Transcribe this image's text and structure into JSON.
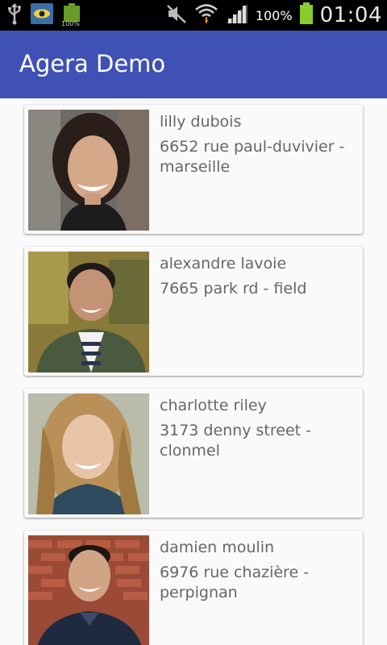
{
  "status_bar": {
    "icons": [
      "usb-icon",
      "eye-app-icon",
      "battery-full-notification-icon",
      "mute-icon",
      "wifi-icon",
      "signal-icon",
      "battery-icon"
    ],
    "battery_notification_text": "100%",
    "battery_percent": "100%",
    "time": "01:04"
  },
  "app_bar": {
    "title": "Agera Demo",
    "color": "#3f51b5"
  },
  "people": [
    {
      "name": "lilly dubois",
      "address": "6652 rue paul-duvivier - marseille"
    },
    {
      "name": "alexandre lavoie",
      "address": "7665 park rd - field"
    },
    {
      "name": "charlotte riley",
      "address": "3173 denny street - clonmel"
    },
    {
      "name": "damien moulin",
      "address": "6976 rue chazière - perpignan"
    }
  ]
}
